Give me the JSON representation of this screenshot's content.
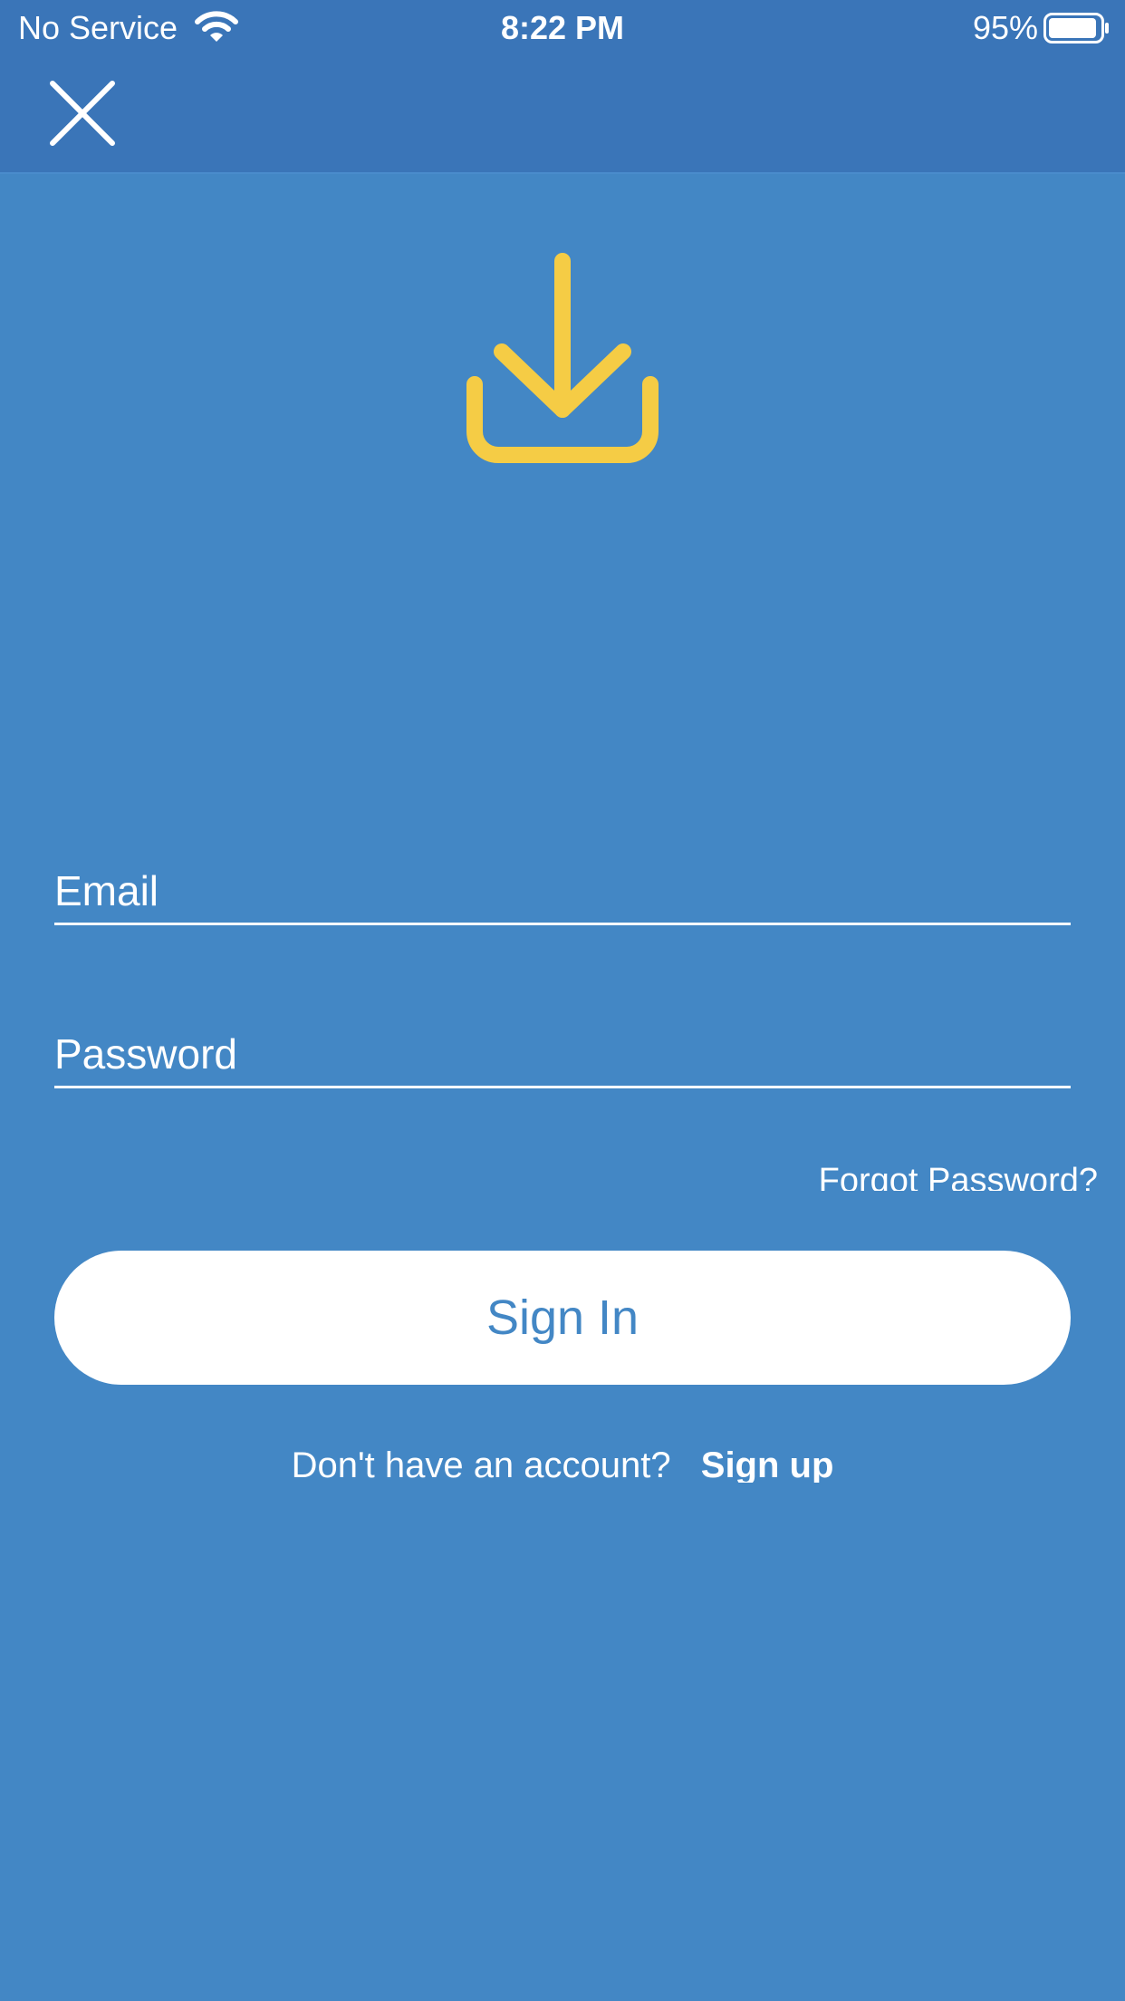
{
  "status_bar": {
    "carrier": "No Service",
    "time": "8:22 PM",
    "battery_percent": "95%",
    "battery_level": 0.95,
    "icons": [
      "wifi-icon",
      "battery-icon"
    ]
  },
  "nav": {
    "close_icon": "close-icon"
  },
  "hero": {
    "icon": "download-tray-icon",
    "color": "#f5cc45"
  },
  "form": {
    "email_placeholder": "Email",
    "password_placeholder": "Password",
    "forgot_password": "Forgot Password?",
    "sign_in_label": "Sign In",
    "signup_prompt": "Don't have an account?",
    "signup_link": "Sign up"
  },
  "colors": {
    "background": "#4387c5",
    "bar": "#3a75b8",
    "button_bg": "#ffffff",
    "button_text": "#4387c5",
    "accent": "#f5cc45"
  }
}
